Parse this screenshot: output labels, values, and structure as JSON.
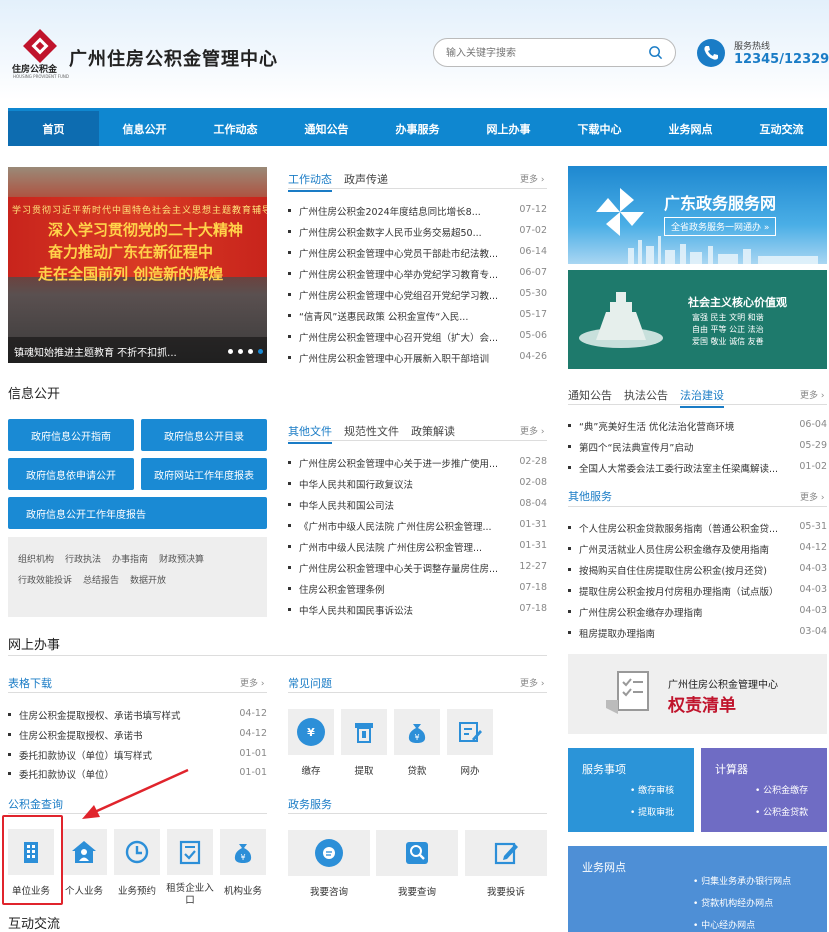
{
  "header": {
    "logo_text": "住房公积金",
    "logo_en": "HOUSING PROVIDENT FUND",
    "site_title": "广州住房公积金管理中心",
    "search_placeholder": "输入关键字搜索",
    "hotline_label": "服务热线",
    "hotline_number": "12345/12329"
  },
  "nav": [
    "首页",
    "信息公开",
    "工作动态",
    "通知公告",
    "办事服务",
    "网上办事",
    "下载中心",
    "业务网点",
    "互动交流"
  ],
  "banner": {
    "line1": "学习贯彻习近平新时代中国特色社会主义思想主题教育辅导讲座",
    "line2": "深入学习贯彻党的二十大精神",
    "line3": "奋力推动广东在新征程中",
    "line4": "走在全国前列 创造新的辉煌",
    "caption": "镇魂知始推进主题教育 不折不扣抓..."
  },
  "news": {
    "tabs": [
      "工作动态",
      "政声传递"
    ],
    "more": "更多",
    "items": [
      {
        "title": "广州住房公积金2024年度结息同比增长8...",
        "date": "07-12"
      },
      {
        "title": "广州住房公积金数字人民币业务交易超50...",
        "date": "07-02"
      },
      {
        "title": "广州住房公积金管理中心党员干部赴市纪法教...",
        "date": "06-14"
      },
      {
        "title": "广州住房公积金管理中心举办党纪学习教育专...",
        "date": "06-07"
      },
      {
        "title": "广州住房公积金管理中心党组召开党纪学习教...",
        "date": "05-30"
      },
      {
        "title": "“信青风”送惠民政策 公积金宣传“入民...",
        "date": "05-17"
      },
      {
        "title": "广州住房公积金管理中心召开党组（扩大）会...",
        "date": "05-06"
      },
      {
        "title": "广州住房公积金管理中心开展新入职干部培训",
        "date": "04-26"
      }
    ]
  },
  "info_open": {
    "title": "信息公开",
    "buttons": [
      "政府信息公开指南",
      "政府信息公开目录",
      "政府信息依申请公开",
      "政府网站工作年度报表",
      "政府信息公开工作年度报告"
    ],
    "links_row1": [
      "组织机构",
      "行政执法",
      "办事指南",
      "财政预决算"
    ],
    "links_row2": [
      "行政效能投诉",
      "总结报告",
      "数据开放"
    ]
  },
  "docs": {
    "tabs": [
      "其他文件",
      "规范性文件",
      "政策解读"
    ],
    "more": "更多",
    "items": [
      {
        "title": "广州住房公积金管理中心关于进一步推广使用...",
        "date": "02-28"
      },
      {
        "title": "中华人民共和国行政复议法",
        "date": "02-08"
      },
      {
        "title": "中华人民共和国公司法",
        "date": "08-04"
      },
      {
        "title": "《广州市中级人民法院 广州住房公积金管理...",
        "date": "01-31"
      },
      {
        "title": "广州市中级人民法院 广州住房公积金管理...",
        "date": "01-31"
      },
      {
        "title": "广州住房公积金管理中心关于调整存量房住房...",
        "date": "12-27"
      },
      {
        "title": "住房公积金管理条例",
        "date": "07-18"
      },
      {
        "title": "中华人民共和国民事诉讼法",
        "date": "07-18"
      }
    ]
  },
  "online": {
    "title": "网上办事",
    "forms_title": "表格下载",
    "forms_more": "更多",
    "forms": [
      {
        "title": "住房公积金提取授权、承诺书填写样式",
        "date": "04-12"
      },
      {
        "title": "住房公积金提取授权、承诺书",
        "date": "04-12"
      },
      {
        "title": "委托扣款协议（单位）填写样式",
        "date": "01-01"
      },
      {
        "title": "委托扣款协议（单位）",
        "date": "01-01"
      }
    ],
    "faq_title": "常见问题",
    "faq_more": "更多",
    "faq": [
      "缴存",
      "提取",
      "贷款",
      "网办"
    ],
    "query_title": "公积金查询",
    "query": [
      "单位业务",
      "个人业务",
      "业务预约",
      "租赁企业入口",
      "机构业务"
    ],
    "gov_title": "政务服务",
    "gov": [
      "我要咨询",
      "我要查询",
      "我要投诉"
    ],
    "interact_title": "互动交流"
  },
  "right": {
    "gd_title": "广东政务服务网",
    "gd_sub": "全省政务服务一网通办 »",
    "ap_title": "社会主义核心价值观",
    "ap_values": [
      "富强 民主 文明 和谐",
      "自由 平等 公正 法治",
      "爱国 敬业 诚信 友善"
    ],
    "notice_tabs": [
      "通知公告",
      "执法公告",
      "法治建设"
    ],
    "notice_more": "更多",
    "notices": [
      {
        "title": "“典”亮美好生活 优化法治化营商环境",
        "date": "06-04"
      },
      {
        "title": "第四个“民法典宣传月”启动",
        "date": "05-29"
      },
      {
        "title": "全国人大常委会法工委行政法室主任梁鹰解读...",
        "date": "01-02"
      }
    ],
    "other_title": "其他服务",
    "other_more": "更多",
    "others": [
      {
        "title": "个人住房公积金贷款服务指南（普通公积金贷...",
        "date": "05-31"
      },
      {
        "title": "广州灵活就业人员住房公积金缴存及使用指南",
        "date": "04-12"
      },
      {
        "title": "按揭购买自住住房提取住房公积金(按月还贷)",
        "date": "04-03"
      },
      {
        "title": "提取住房公积金按月付房租办理指南（试点版）",
        "date": "04-03"
      },
      {
        "title": "广州住房公积金缴存办理指南",
        "date": "04-03"
      },
      {
        "title": "租房提取办理指南",
        "date": "03-04"
      }
    ],
    "quan_small": "广州住房公积金管理中心",
    "quan_big": "权责清单",
    "svc_title": "服务事项",
    "svc_items": [
      "缴存审核",
      "提取审批"
    ],
    "calc_title": "计算器",
    "calc_items": [
      "公积金缴存",
      "公积金贷款"
    ],
    "outlet_title": "业务网点",
    "outlet_items": [
      "归集业务承办银行网点",
      "贷款机构经办网点",
      "中心经办网点"
    ]
  },
  "colors": {
    "primary": "#0f87d0",
    "brand_red": "#c0142c",
    "annotation_red": "#e0242c"
  }
}
